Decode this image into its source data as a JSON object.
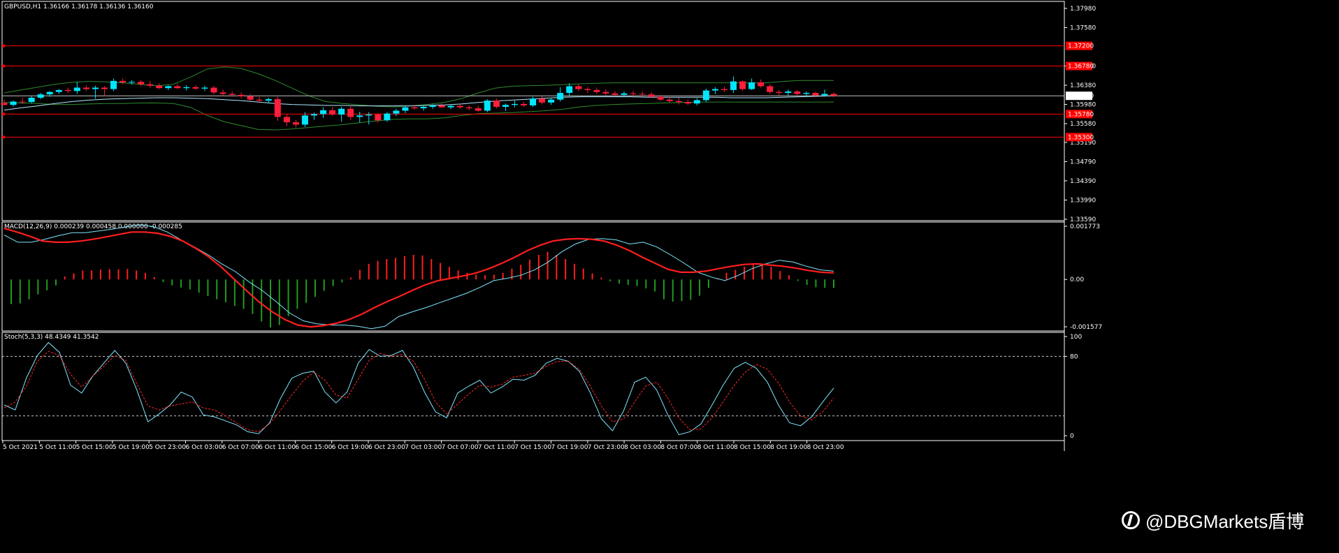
{
  "chart_data": [
    {
      "type": "candlestick",
      "title": "GBPUSD,H1  1.36166 1.36178 1.36136 1.36160",
      "ylim": [
        1.3359,
        1.3798
      ],
      "yticks": [
        "1.37980",
        "1.37580",
        "1.36780",
        "1.36380",
        "1.35980",
        "1.35580",
        "1.35190",
        "1.34790",
        "1.34390",
        "1.33990",
        "1.33590"
      ],
      "current_price": "1.36160",
      "hlines": [
        {
          "value": 1.372,
          "label": "1.37200",
          "color": "#ff0000"
        },
        {
          "value": 1.3678,
          "label": "1.36780",
          "color": "#ff0000"
        },
        {
          "value": 1.3578,
          "label": "1.35780",
          "color": "#ff0000"
        },
        {
          "value": 1.353,
          "label": "1.35300",
          "color": "#ff0000"
        }
      ],
      "candles": [
        [
          1.3601,
          1.3608,
          1.3596,
          1.3597
        ],
        [
          1.3597,
          1.3606,
          1.3594,
          1.3604
        ],
        [
          1.3604,
          1.3612,
          1.3599,
          1.3603
        ],
        [
          1.3603,
          1.3615,
          1.3601,
          1.3612
        ],
        [
          1.3612,
          1.3622,
          1.3609,
          1.3619
        ],
        [
          1.3619,
          1.3626,
          1.3614,
          1.3624
        ],
        [
          1.3624,
          1.363,
          1.362,
          1.3628
        ],
        [
          1.3628,
          1.3633,
          1.3622,
          1.3626
        ],
        [
          1.3626,
          1.3645,
          1.362,
          1.3633
        ],
        [
          1.3633,
          1.3638,
          1.3626,
          1.363
        ],
        [
          1.363,
          1.3637,
          1.361,
          1.3633
        ],
        [
          1.3633,
          1.3636,
          1.3615,
          1.363
        ],
        [
          1.363,
          1.3652,
          1.3626,
          1.3647
        ],
        [
          1.3647,
          1.3652,
          1.364,
          1.3644
        ],
        [
          1.3644,
          1.3648,
          1.3639,
          1.3645
        ],
        [
          1.3645,
          1.3649,
          1.3637,
          1.364
        ],
        [
          1.364,
          1.3647,
          1.3633,
          1.3637
        ],
        [
          1.3637,
          1.3642,
          1.363,
          1.3632
        ],
        [
          1.3632,
          1.3638,
          1.3628,
          1.3636
        ],
        [
          1.3636,
          1.3641,
          1.363,
          1.3632
        ],
        [
          1.3632,
          1.3638,
          1.3627,
          1.3634
        ],
        [
          1.3634,
          1.3638,
          1.3628,
          1.3631
        ],
        [
          1.3631,
          1.3637,
          1.3626,
          1.3633
        ],
        [
          1.3633,
          1.3636,
          1.3619,
          1.3623
        ],
        [
          1.3623,
          1.3629,
          1.3616,
          1.362
        ],
        [
          1.362,
          1.3625,
          1.3614,
          1.3618
        ],
        [
          1.3618,
          1.3623,
          1.3611,
          1.3615
        ],
        [
          1.3615,
          1.362,
          1.3605,
          1.3608
        ],
        [
          1.3608,
          1.3614,
          1.3601,
          1.3606
        ],
        [
          1.3606,
          1.3612,
          1.36,
          1.3609
        ],
        [
          1.3609,
          1.3614,
          1.3564,
          1.3572
        ],
        [
          1.3572,
          1.3578,
          1.3553,
          1.3561
        ],
        [
          1.3561,
          1.3566,
          1.355,
          1.3556
        ],
        [
          1.3556,
          1.3582,
          1.3551,
          1.3575
        ],
        [
          1.3575,
          1.3581,
          1.3566,
          1.3578
        ],
        [
          1.3578,
          1.3592,
          1.357,
          1.3586
        ],
        [
          1.3586,
          1.3592,
          1.3574,
          1.3577
        ],
        [
          1.3577,
          1.3593,
          1.3562,
          1.3589
        ],
        [
          1.3589,
          1.3594,
          1.3566,
          1.3572
        ],
        [
          1.3572,
          1.3583,
          1.356,
          1.3575
        ],
        [
          1.3575,
          1.3582,
          1.3556,
          1.3577
        ],
        [
          1.3577,
          1.358,
          1.356,
          1.3565
        ],
        [
          1.3565,
          1.3582,
          1.3562,
          1.3579
        ],
        [
          1.3579,
          1.3589,
          1.3574,
          1.3585
        ],
        [
          1.3585,
          1.3595,
          1.358,
          1.3592
        ],
        [
          1.3592,
          1.3597,
          1.3587,
          1.359
        ],
        [
          1.359,
          1.3596,
          1.3585,
          1.3593
        ],
        [
          1.3593,
          1.3598,
          1.3589,
          1.3596
        ],
        [
          1.3596,
          1.36,
          1.3591,
          1.3592
        ],
        [
          1.3592,
          1.3598,
          1.3588,
          1.3595
        ],
        [
          1.3595,
          1.3599,
          1.3589,
          1.3592
        ],
        [
          1.3592,
          1.3596,
          1.3586,
          1.359
        ],
        [
          1.359,
          1.3595,
          1.3583,
          1.3585
        ],
        [
          1.3585,
          1.3609,
          1.3582,
          1.3606
        ],
        [
          1.3606,
          1.361,
          1.359,
          1.3593
        ],
        [
          1.3593,
          1.36,
          1.3584,
          1.3597
        ],
        [
          1.3597,
          1.3606,
          1.3592,
          1.3599
        ],
        [
          1.3599,
          1.3603,
          1.3593,
          1.3596
        ],
        [
          1.3596,
          1.3614,
          1.3593,
          1.361
        ],
        [
          1.361,
          1.3615,
          1.3598,
          1.3602
        ],
        [
          1.3602,
          1.3612,
          1.3597,
          1.3608
        ],
        [
          1.3608,
          1.3634,
          1.3604,
          1.3622
        ],
        [
          1.3622,
          1.3642,
          1.3616,
          1.3636
        ],
        [
          1.3636,
          1.364,
          1.3626,
          1.363
        ],
        [
          1.363,
          1.3634,
          1.3622,
          1.3628
        ],
        [
          1.3628,
          1.3633,
          1.362,
          1.3624
        ],
        [
          1.3624,
          1.3629,
          1.3617,
          1.3621
        ],
        [
          1.3621,
          1.3626,
          1.3615,
          1.3618
        ],
        [
          1.3618,
          1.3625,
          1.3613,
          1.3621
        ],
        [
          1.3621,
          1.3626,
          1.3615,
          1.362
        ],
        [
          1.362,
          1.3625,
          1.3614,
          1.3619
        ],
        [
          1.3619,
          1.3624,
          1.3612,
          1.3614
        ],
        [
          1.3614,
          1.3618,
          1.3605,
          1.3608
        ],
        [
          1.3608,
          1.3614,
          1.3602,
          1.3605
        ],
        [
          1.3605,
          1.3612,
          1.3598,
          1.3603
        ],
        [
          1.3603,
          1.3608,
          1.3597,
          1.36
        ],
        [
          1.36,
          1.3611,
          1.3596,
          1.3607
        ],
        [
          1.3607,
          1.3631,
          1.3604,
          1.3627
        ],
        [
          1.3627,
          1.3634,
          1.362,
          1.363
        ],
        [
          1.363,
          1.3635,
          1.3624,
          1.3628
        ],
        [
          1.3628,
          1.3656,
          1.3622,
          1.3646
        ],
        [
          1.3646,
          1.3648,
          1.3626,
          1.363
        ],
        [
          1.363,
          1.3652,
          1.3628,
          1.3644
        ],
        [
          1.3644,
          1.365,
          1.3633,
          1.3636
        ],
        [
          1.3636,
          1.364,
          1.362,
          1.3624
        ],
        [
          1.3624,
          1.3628,
          1.3617,
          1.3622
        ],
        [
          1.3622,
          1.3629,
          1.3617,
          1.3625
        ],
        [
          1.3625,
          1.3628,
          1.3616,
          1.362
        ],
        [
          1.362,
          1.3625,
          1.3613,
          1.3622
        ],
        [
          1.3622,
          1.3624,
          1.3613,
          1.3617
        ],
        [
          1.3617,
          1.3629,
          1.3614,
          1.362
        ],
        [
          1.362,
          1.3623,
          1.3613,
          1.3616
        ]
      ],
      "bands": {
        "upper": [
          1.3622,
          1.3628,
          1.3634,
          1.364,
          1.3644,
          1.3646,
          1.3645,
          1.3643,
          1.364,
          1.3637,
          1.364,
          1.3655,
          1.3672,
          1.3676,
          1.3673,
          1.3662,
          1.3648,
          1.3632,
          1.3616,
          1.3604,
          1.36,
          1.3597,
          1.3594,
          1.3593,
          1.3595,
          1.3598,
          1.3602,
          1.361,
          1.3622,
          1.3632,
          1.3636,
          1.3637,
          1.3638,
          1.3639,
          1.3641,
          1.3642,
          1.3643,
          1.3643,
          1.3643,
          1.3643,
          1.3643,
          1.3643,
          1.3643,
          1.3643,
          1.3643,
          1.3643,
          1.3646,
          1.3648,
          1.3648,
          1.3648
        ],
        "lower": [
          1.3602,
          1.3601,
          1.36,
          1.3598,
          1.3598,
          1.3599,
          1.36,
          1.36,
          1.3601,
          1.3601,
          1.36,
          1.3592,
          1.3575,
          1.3562,
          1.3554,
          1.3546,
          1.3545,
          1.3547,
          1.355,
          1.3553,
          1.3556,
          1.356,
          1.3564,
          1.3567,
          1.3568,
          1.3568,
          1.357,
          1.3575,
          1.3579,
          1.358,
          1.3581,
          1.3583,
          1.3585,
          1.3588,
          1.3593,
          1.3596,
          1.3598,
          1.3599,
          1.36,
          1.3601,
          1.3602,
          1.3603,
          1.3603,
          1.3603,
          1.3603,
          1.3603,
          1.3603,
          1.3603,
          1.3603,
          1.3603
        ],
        "ma": [
          1.3586,
          1.3591,
          1.3595,
          1.36,
          1.3604,
          1.3607,
          1.3609,
          1.361,
          1.3611,
          1.3612,
          1.3612,
          1.3611,
          1.361,
          1.3608,
          1.3606,
          1.3603,
          1.36,
          1.3598,
          1.3597,
          1.3596,
          1.3596,
          1.3595,
          1.3595,
          1.3595,
          1.3595,
          1.3596,
          1.3597,
          1.3599,
          1.3602,
          1.3605,
          1.3607,
          1.3609,
          1.3611,
          1.3613,
          1.3614,
          1.3614,
          1.3614,
          1.3614,
          1.3613,
          1.3613,
          1.3613,
          1.3613,
          1.3613,
          1.3612,
          1.3612,
          1.3612,
          1.3613,
          1.3614,
          1.3615,
          1.3616
        ]
      }
    },
    {
      "type": "bar",
      "title": "MACD(12,26,9) 0.000239 0.000458 0.000000 -0.000285",
      "ylim": [
        -0.001577,
        0.001773
      ],
      "yticks": [
        "0.001773",
        "0.00",
        "-0.001577"
      ],
      "histogram": [
        -0.00082,
        -0.0008,
        -0.00066,
        -0.0005,
        -0.00036,
        -0.0002,
        0.0001,
        0.0002,
        0.0003,
        0.0003,
        0.00033,
        0.00034,
        0.00034,
        0.00035,
        0.0003,
        0.00022,
        8e-05,
        -9e-05,
        -0.0002,
        -0.00027,
        -0.00033,
        -0.00044,
        -0.00055,
        -0.00066,
        -0.00076,
        -0.00088,
        -0.00098,
        -0.00115,
        -0.0014,
        -0.0016,
        -0.00152,
        -0.00122,
        -0.00098,
        -0.00078,
        -0.00058,
        -0.00038,
        -0.00022,
        -0.0001,
        6e-05,
        0.00032,
        0.00052,
        0.00062,
        0.00068,
        0.00072,
        0.00078,
        0.00082,
        0.0008,
        0.00068,
        0.00055,
        0.00042,
        0.0003,
        0.00022,
        0.00016,
        0.00014,
        0.00016,
        0.00022,
        0.00036,
        0.00049,
        0.00066,
        0.00082,
        0.00092,
        0.00082,
        0.00068,
        0.00052,
        0.00036,
        0.0002,
        6e-05,
        -6e-05,
        -0.00014,
        -0.00018,
        -0.00022,
        -0.0003,
        -0.0004,
        -0.00066,
        -0.00074,
        -0.00072,
        -0.00068,
        -0.00054,
        -0.00028,
        4e-05,
        0.00022,
        0.00032,
        0.00042,
        0.00048,
        0.00049,
        0.00042,
        0.00028,
        0.00014,
        -5e-05,
        -0.00018,
        -0.00026,
        -0.00028,
        -0.00028
      ],
      "macd": [
        0.00148,
        0.00124,
        0.00124,
        0.00134,
        0.00146,
        0.00156,
        0.00156,
        0.00162,
        0.00168,
        0.00176,
        0.00182,
        0.00176,
        0.00158,
        0.00132,
        0.00108,
        0.00082,
        0.00052,
        0.00026,
        -8e-05,
        -0.00038,
        -0.00074,
        -0.00112,
        -0.00138,
        -0.00148,
        -0.00152,
        -0.00152,
        -0.00156,
        -0.00164,
        -0.00156,
        -0.00124,
        -0.00108,
        -0.00094,
        -0.00078,
        -0.00062,
        -0.00046,
        -0.00026,
        -4e-05,
        4e-05,
        0.00014,
        0.00032,
        0.00058,
        0.00092,
        0.00118,
        0.00134,
        0.00136,
        0.00132,
        0.00118,
        0.00124,
        0.00108,
        0.00082,
        0.00054,
        0.00024,
        8e-05,
        -4e-05,
        0.00014,
        0.00036,
        0.00052,
        0.00064,
        0.00058,
        0.00044,
        0.00032,
        0.00028
      ],
      "signal": [
        0.0017,
        0.00158,
        0.00144,
        0.00128,
        0.00124,
        0.00124,
        0.00128,
        0.00134,
        0.00142,
        0.0015,
        0.00158,
        0.00158,
        0.00154,
        0.00144,
        0.00128,
        0.00104,
        0.00076,
        0.00042,
        2e-05,
        -0.00038,
        -0.00076,
        -0.00108,
        -0.00134,
        -0.00152,
        -0.00158,
        -0.00154,
        -0.00146,
        -0.00134,
        -0.00116,
        -0.00094,
        -0.00074,
        -0.00056,
        -0.00036,
        -0.00018,
        -4e-05,
        4e-05,
        0.00012,
        0.00022,
        0.00036,
        0.00054,
        0.00074,
        0.00096,
        0.00114,
        0.00128,
        0.00134,
        0.00136,
        0.00134,
        0.00128,
        0.00114,
        0.00096,
        0.00074,
        0.00054,
        0.00034,
        0.00024,
        0.00024,
        0.00028,
        0.00036,
        0.00044,
        0.0005,
        0.00052,
        0.00048,
        0.00044,
        0.00038,
        0.0003,
        0.00024,
        0.00022
      ]
    },
    {
      "type": "line",
      "title": "Stoch(5,3,3) 48.4349 41.3542",
      "ylim": [
        0,
        100
      ],
      "yticks": [
        "100",
        "80",
        "0"
      ],
      "levels": [
        80,
        20
      ],
      "main": [
        31,
        26,
        58,
        81,
        94,
        84,
        51,
        43,
        60,
        73,
        86,
        73,
        46,
        14,
        22,
        31,
        44,
        39,
        21,
        19,
        15,
        11,
        4,
        2,
        13,
        38,
        58,
        63,
        65,
        44,
        33,
        44,
        73,
        87,
        80,
        81,
        86,
        69,
        44,
        24,
        18,
        43,
        50,
        56,
        43,
        49,
        57,
        56,
        61,
        73,
        78,
        75,
        65,
        43,
        17,
        5,
        25,
        54,
        59,
        46,
        21,
        1,
        4,
        12,
        31,
        51,
        68,
        74,
        68,
        54,
        31,
        13,
        10,
        19,
        34,
        48
      ],
      "signal": [
        28,
        34,
        50,
        75,
        85,
        81,
        62,
        49,
        60,
        70,
        81,
        76,
        52,
        30,
        26,
        30,
        32,
        34,
        28,
        26,
        20,
        13,
        6,
        4,
        12,
        26,
        41,
        55,
        64,
        56,
        41,
        38,
        57,
        76,
        83,
        80,
        82,
        75,
        57,
        34,
        22,
        32,
        42,
        51,
        49,
        52,
        59,
        61,
        63,
        70,
        75,
        75,
        67,
        50,
        30,
        14,
        17,
        34,
        50,
        54,
        38,
        18,
        6,
        7,
        18,
        34,
        51,
        64,
        72,
        67,
        53,
        34,
        20,
        16,
        24,
        38
      ],
      "xlabels": [
        "5 Oct 2021",
        "5 Oct 11:00",
        "5 Oct 15:00",
        "5 Oct 19:00",
        "5 Oct 23:00",
        "6 Oct 03:00",
        "6 Oct 07:00",
        "6 Oct 11:00",
        "6 Oct 15:00",
        "6 Oct 19:00",
        "6 Oct 23:00",
        "7 Oct 03:00",
        "7 Oct 07:00",
        "7 Oct 11:00",
        "7 Oct 15:00",
        "7 Oct 19:00",
        "7 Oct 23:00",
        "8 Oct 03:00",
        "8 Oct 07:00",
        "8 Oct 11:00",
        "8 Oct 15:00",
        "8 Oct 19:00",
        "8 Oct 23:00"
      ]
    }
  ],
  "watermark": "@DBGMarkets盾博",
  "colors": {
    "bull": "#00e5ff",
    "bear": "#ff1e3c",
    "band": "#2e8b2e",
    "ma": "#b0e8ff",
    "grid": "#ffffff",
    "hline": "#ff0000",
    "hist_pos": "#ff1e1e",
    "hist_neg": "#1f9b1f",
    "macd": "#7fe7ff",
    "signal": "#ff1e1e",
    "stoch_main": "#7fe7ff",
    "stoch_sig": "#ff2a2a"
  }
}
